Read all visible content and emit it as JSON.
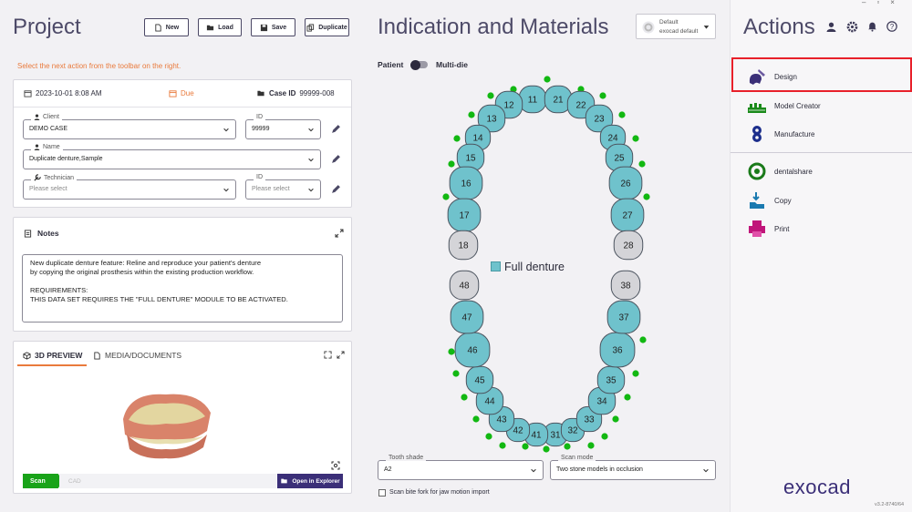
{
  "window_controls": [
    "–",
    "▫",
    "×"
  ],
  "project": {
    "title": "Project",
    "buttons": {
      "new": "New",
      "load": "Load",
      "save": "Save",
      "duplicate": "Duplicate"
    },
    "instruction": "Select the next action from the toolbar on the right.",
    "date": "2023-10-01 8:08 AM",
    "status": "Due",
    "case_id_label": "Case ID",
    "case_id": "99999-008",
    "client": {
      "label": "Client",
      "value": "DEMO CASE"
    },
    "client_id": {
      "label": "ID",
      "value": "99999"
    },
    "name": {
      "label": "Name",
      "value": "Duplicate denture,Sample"
    },
    "technician": {
      "label": "Technician",
      "placeholder": "Please select"
    },
    "tech_id": {
      "label": "ID",
      "placeholder": "Please select"
    }
  },
  "notes": {
    "title": "Notes",
    "line1": "New duplicate denture feature: Reline and reproduce your patient's denture",
    "line2": "by copying the original prosthesis within the existing production workflow.",
    "line3": "REQUIREMENTS:",
    "line4": "THIS DATA SET REQUIRES THE \"FULL DENTURE\" MODULE TO BE ACTIVATED."
  },
  "preview": {
    "tab_3d": "3D PREVIEW",
    "tab_media": "MEDIA/DOCUMENTS",
    "step_scan": "Scan",
    "step_cad": "CAD",
    "open_explorer": "Open in Explorer"
  },
  "indication": {
    "title": "Indication and Materials",
    "profile_label": "Default",
    "profile_value": "exocad default",
    "toggle_left": "Patient",
    "toggle_right": "Multi-die",
    "legend": "Full denture",
    "tooth_shade_label": "Tooth shade",
    "tooth_shade_value": "A2",
    "scan_mode_label": "Scan mode",
    "scan_mode_value": "Two stone models in occlusion",
    "bite_fork_label": "Scan bite fork for jaw motion import",
    "colors": {
      "tooth_selected": "#6fc2cc",
      "tooth_unselected": "#d4d4d8",
      "dot": "#12b812"
    }
  },
  "teeth": {
    "upper": [
      "11",
      "12",
      "13",
      "14",
      "15",
      "16",
      "17",
      "18",
      "21",
      "22",
      "23",
      "24",
      "25",
      "26",
      "27",
      "28"
    ],
    "lower": [
      "31",
      "32",
      "33",
      "34",
      "35",
      "36",
      "37",
      "38",
      "41",
      "42",
      "43",
      "44",
      "45",
      "46",
      "47",
      "48"
    ]
  },
  "actions": {
    "title": "Actions",
    "items": {
      "design": "Design",
      "model_creator": "Model Creator",
      "manufacture": "Manufacture",
      "dentalshare": "dentalshare",
      "copy": "Copy",
      "print": "Print"
    },
    "logo": "exocad",
    "version": "v3.2-8740/64",
    "highlight_color": "#e8202a",
    "accent": "#3b2f78"
  }
}
